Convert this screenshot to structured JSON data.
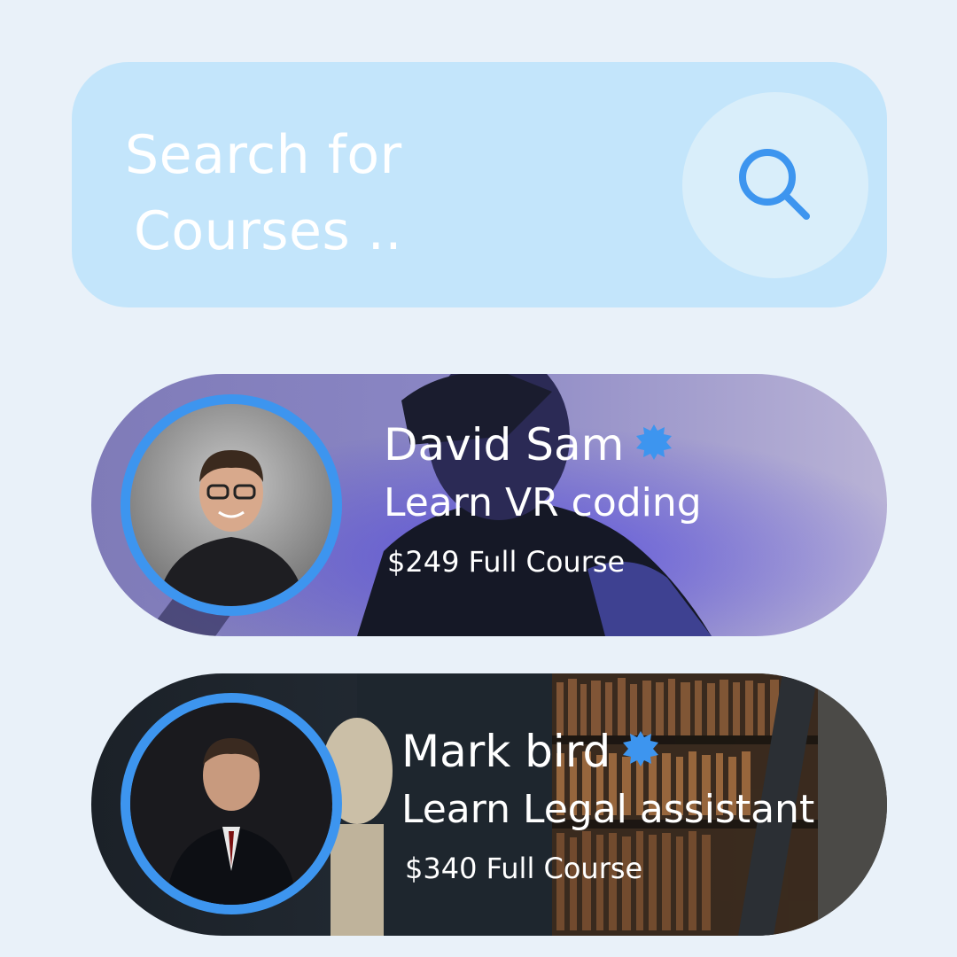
{
  "search": {
    "placeholder_line1": "Search for",
    "placeholder_line2": "Courses ..",
    "icon": "search-icon"
  },
  "courses": [
    {
      "name": "David Sam",
      "course": "Learn VR coding",
      "price": "$249 Full Course",
      "verified_icon": "verified-badge-icon",
      "accent": "#3d95ef"
    },
    {
      "name": "Mark bird",
      "course": "Learn Legal assistant",
      "price": "$340 Full Course",
      "verified_icon": "verified-badge-icon",
      "accent": "#3d95ef"
    }
  ]
}
